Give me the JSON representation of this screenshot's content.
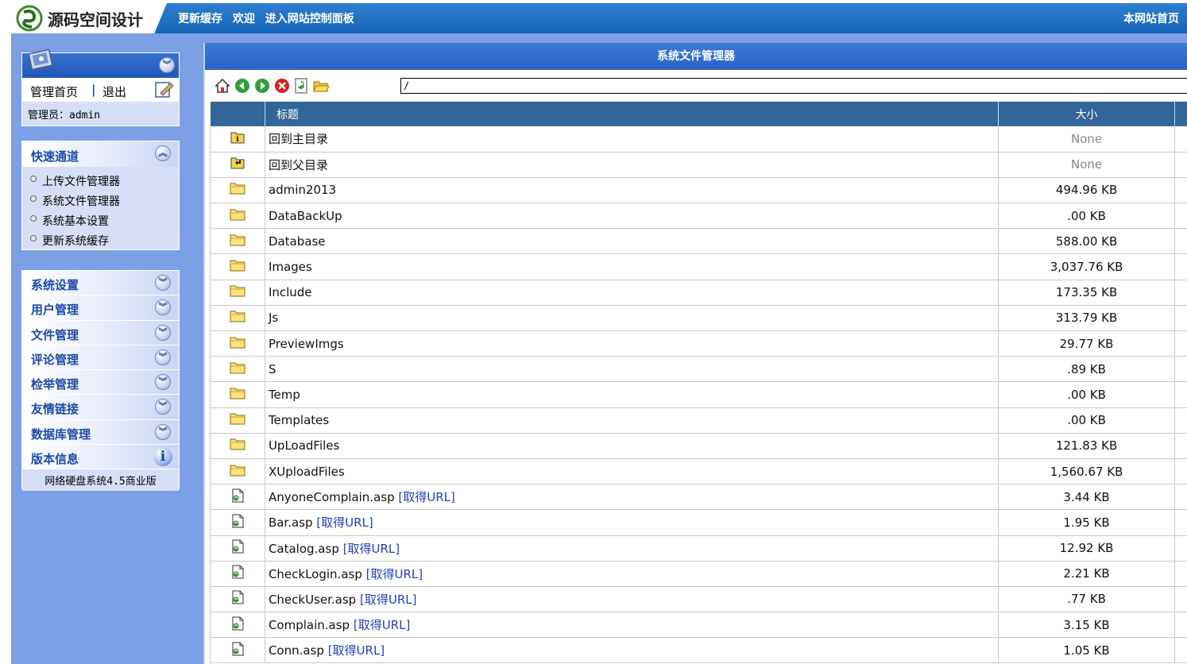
{
  "header": {
    "site_title": "源码空间设计",
    "nav": [
      "更新缓存",
      "欢迎",
      "进入网站控制面板"
    ],
    "home_link": "本网站首页"
  },
  "sidebar": {
    "top_links": {
      "home": "管理首页",
      "separator": "|",
      "logout": "退出"
    },
    "admin_label": "管理员：admin",
    "quick_title": "快速通道",
    "quick_links": [
      "上传文件管理器",
      "系统文件管理器",
      "系统基本设置",
      "更新系统缓存"
    ],
    "menu": [
      "系统设置",
      "用户管理",
      "文件管理",
      "评论管理",
      "检举管理",
      "友情链接",
      "数据库管理",
      "版本信息"
    ],
    "version_text": "网络硬盘系统4.5商业版"
  },
  "panel": {
    "title": "系统文件管理器",
    "path_value": "/",
    "columns": [
      "标题",
      "大小"
    ],
    "get_url_label": "[取得URL]",
    "rows": [
      {
        "icon": "root-dir",
        "name": "回到主目录",
        "size": "None",
        "file": false
      },
      {
        "icon": "parent-dir",
        "name": "回到父目录",
        "size": "None",
        "file": false
      },
      {
        "icon": "folder",
        "name": "admin2013",
        "size": "494.96 KB",
        "file": false
      },
      {
        "icon": "folder",
        "name": "DataBackUp",
        "size": ".00 KB",
        "file": false
      },
      {
        "icon": "folder",
        "name": "Database",
        "size": "588.00 KB",
        "file": false
      },
      {
        "icon": "folder",
        "name": "Images",
        "size": "3,037.76 KB",
        "file": false
      },
      {
        "icon": "folder",
        "name": "Include",
        "size": "173.35 KB",
        "file": false
      },
      {
        "icon": "folder",
        "name": "Js",
        "size": "313.79 KB",
        "file": false
      },
      {
        "icon": "folder",
        "name": "PreviewImgs",
        "size": "29.77 KB",
        "file": false
      },
      {
        "icon": "folder",
        "name": "S",
        "size": ".89 KB",
        "file": false
      },
      {
        "icon": "folder",
        "name": "Temp",
        "size": ".00 KB",
        "file": false
      },
      {
        "icon": "folder",
        "name": "Templates",
        "size": ".00 KB",
        "file": false
      },
      {
        "icon": "folder",
        "name": "UpLoadFiles",
        "size": "121.83 KB",
        "file": false
      },
      {
        "icon": "folder",
        "name": "XUploadFiles",
        "size": "1,560.67 KB",
        "file": false
      },
      {
        "icon": "asp-file",
        "name": "AnyoneComplain.asp",
        "size": "3.44 KB",
        "file": true
      },
      {
        "icon": "asp-file",
        "name": "Bar.asp",
        "size": "1.95 KB",
        "file": true
      },
      {
        "icon": "asp-file",
        "name": "Catalog.asp",
        "size": "12.92 KB",
        "file": true
      },
      {
        "icon": "asp-file",
        "name": "CheckLogin.asp",
        "size": "2.21 KB",
        "file": true
      },
      {
        "icon": "asp-file",
        "name": "CheckUser.asp",
        "size": ".77 KB",
        "file": true
      },
      {
        "icon": "asp-file",
        "name": "Complain.asp",
        "size": "3.15 KB",
        "file": true
      },
      {
        "icon": "asp-file",
        "name": "Conn.asp",
        "size": "1.05 KB",
        "file": true
      }
    ]
  },
  "colors": {
    "header_blue": "#1a6bc0",
    "sidebar_blue": "#7c9fe6",
    "table_header": "#336699",
    "link_blue": "#1f3fbf"
  }
}
